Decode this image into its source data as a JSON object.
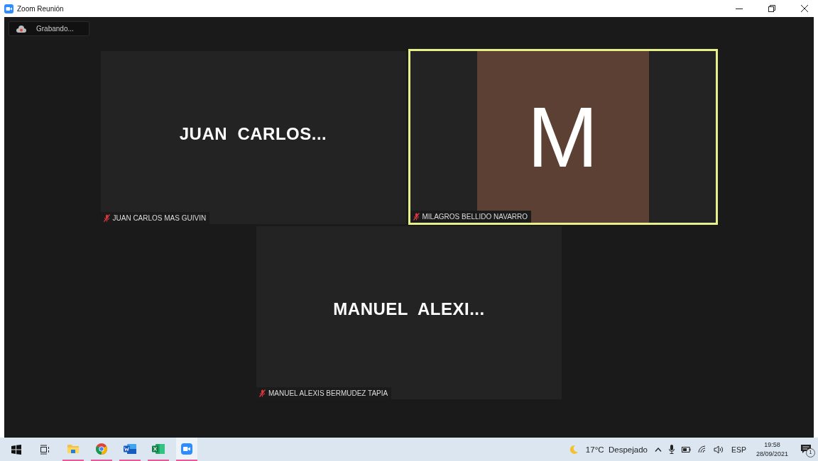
{
  "window": {
    "title": "Zoom Reunión"
  },
  "recording": {
    "label": "Grabando..."
  },
  "participants": [
    {
      "kind": "name",
      "display": "JUAN  CARLOS...",
      "name": "JUAN CARLOS MAS GUIVIN",
      "muted": true,
      "speaking": false
    },
    {
      "kind": "avatar",
      "display": "M",
      "name": "MILAGROS BELLIDO NAVARRO",
      "muted": true,
      "speaking": true
    },
    {
      "kind": "name",
      "display": "MANUEL  ALEXI...",
      "name": "MANUEL ALEXIS BERMUDEZ TAPIA",
      "muted": true,
      "speaking": false
    }
  ],
  "taskbar": {
    "apps": [
      {
        "kind": "start",
        "running": false,
        "selected": false
      },
      {
        "kind": "taskview",
        "running": false,
        "selected": false
      },
      {
        "kind": "explorer",
        "running": true,
        "selected": false
      },
      {
        "kind": "chrome",
        "running": true,
        "selected": false
      },
      {
        "kind": "word",
        "running": true,
        "selected": false
      },
      {
        "kind": "excel",
        "running": true,
        "selected": false
      },
      {
        "kind": "zoom",
        "running": true,
        "selected": true
      }
    ],
    "weather": "17°C  Despejado",
    "language": "ESP",
    "time": "19:58",
    "date": "28/09/2021",
    "notifications": "1"
  }
}
